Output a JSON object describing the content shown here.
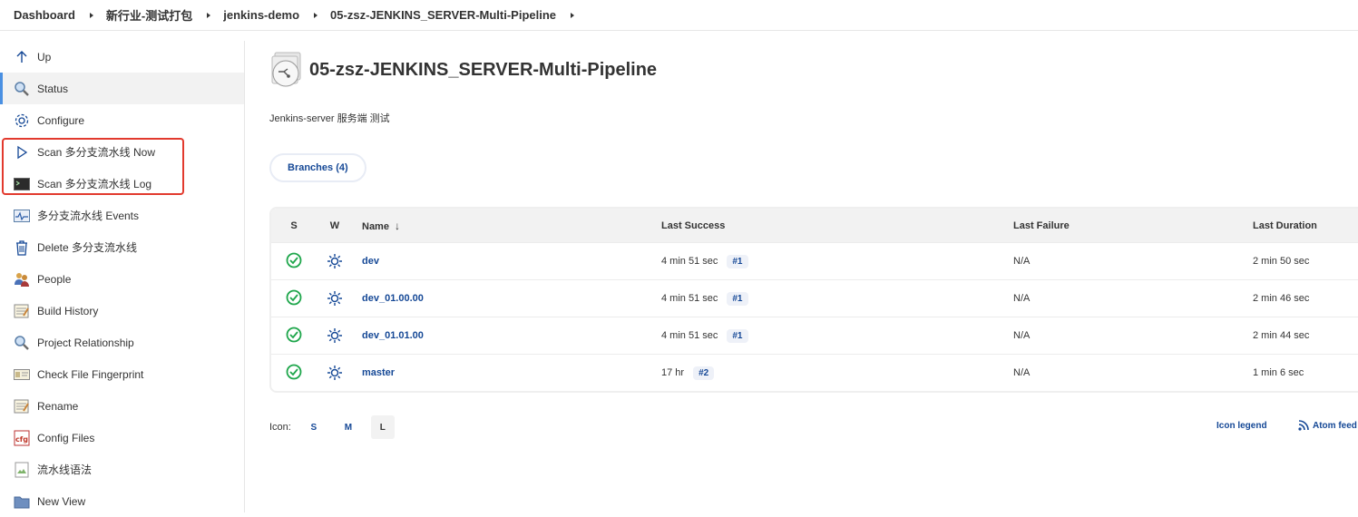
{
  "breadcrumb": [
    "Dashboard",
    "新行业-测试打包",
    "jenkins-demo",
    "05-zsz-JENKINS_SERVER-Multi-Pipeline"
  ],
  "sidebar": {
    "items": [
      {
        "label": "Up",
        "icon": "arrow-up-icon"
      },
      {
        "label": "Status",
        "icon": "magnifier-icon"
      },
      {
        "label": "Configure",
        "icon": "gear-icon"
      },
      {
        "label": "Scan 多分支流水线 Now",
        "icon": "play-icon"
      },
      {
        "label": "Scan 多分支流水线 Log",
        "icon": "terminal-icon"
      },
      {
        "label": "多分支流水线 Events",
        "icon": "events-icon"
      },
      {
        "label": "Delete 多分支流水线",
        "icon": "trash-icon"
      },
      {
        "label": "People",
        "icon": "people-icon"
      },
      {
        "label": "Build History",
        "icon": "notepad-icon"
      },
      {
        "label": "Project Relationship",
        "icon": "magnifier-icon"
      },
      {
        "label": "Check File Fingerprint",
        "icon": "fingerprint-icon"
      },
      {
        "label": "Rename",
        "icon": "notepad-icon"
      },
      {
        "label": "Config Files",
        "icon": "cfg-icon"
      },
      {
        "label": "流水线语法",
        "icon": "broken-image-icon"
      },
      {
        "label": "New View",
        "icon": "folder-icon"
      }
    ]
  },
  "main": {
    "title": "05-zsz-JENKINS_SERVER-Multi-Pipeline",
    "description": "Jenkins-server 服务端 测试",
    "tab_label": "Branches (4)",
    "table": {
      "headers": {
        "s": "S",
        "w": "W",
        "name": "Name",
        "sort": "↓",
        "last_success": "Last Success",
        "last_failure": "Last Failure",
        "last_duration": "Last Duration"
      },
      "rows": [
        {
          "name": "dev",
          "last_success": "4 min 51 sec",
          "build": "#1",
          "last_failure": "N/A",
          "last_duration": "2 min 50 sec"
        },
        {
          "name": "dev_01.00.00",
          "last_success": "4 min 51 sec",
          "build": "#1",
          "last_failure": "N/A",
          "last_duration": "2 min 46 sec"
        },
        {
          "name": "dev_01.01.00",
          "last_success": "4 min 51 sec",
          "build": "#1",
          "last_failure": "N/A",
          "last_duration": "2 min 44 sec"
        },
        {
          "name": "master",
          "last_success": "17 hr",
          "build": "#2",
          "last_failure": "N/A",
          "last_duration": "1 min 6 sec"
        }
      ]
    },
    "icon_size": {
      "label": "Icon:",
      "options": [
        "S",
        "M",
        "L"
      ],
      "selected": "L"
    },
    "icon_legend": "Icon legend",
    "atom_feed": "Atom feed for all"
  },
  "colors": {
    "link": "#154896",
    "success": "#1ea64b",
    "highlight": "#e23a2e",
    "active_border": "#4a90e2"
  }
}
